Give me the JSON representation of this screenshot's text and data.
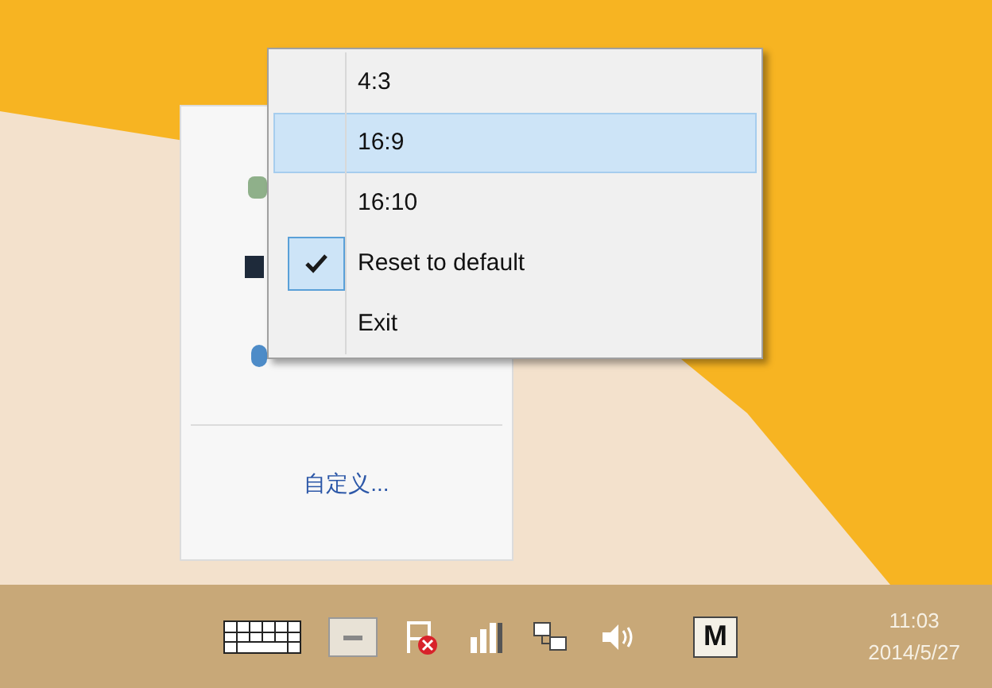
{
  "context_menu": {
    "items": [
      {
        "label": "4:3",
        "selected": false,
        "checked": false
      },
      {
        "label": "16:9",
        "selected": true,
        "checked": false
      },
      {
        "label": "16:10",
        "selected": false,
        "checked": false
      },
      {
        "label": "Reset to default",
        "selected": false,
        "checked": true
      },
      {
        "label": "Exit",
        "selected": false,
        "checked": false
      }
    ]
  },
  "tray_overflow": {
    "customize_link": "自定义..."
  },
  "taskbar": {
    "input_indicator": "M",
    "time": "11:03",
    "date": "2014/5/27"
  }
}
